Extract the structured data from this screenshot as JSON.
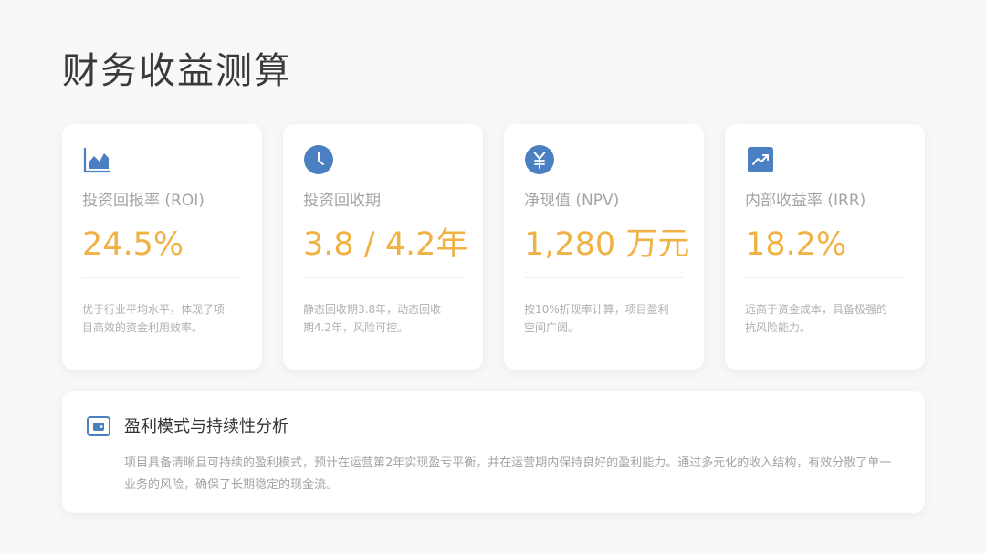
{
  "page": {
    "title": "财务收益测算"
  },
  "metrics": [
    {
      "icon": "area-chart-icon",
      "label": "投资回报率 (ROI)",
      "value": "24.5%",
      "description": "优于行业平均水平，体现了项目高效的资金利用效率。"
    },
    {
      "icon": "clock-icon",
      "label": "投资回收期",
      "value": "3.8 / 4.2年",
      "description": "静态回收期3.8年，动态回收期4.2年，风险可控。"
    },
    {
      "icon": "yen-icon",
      "label": "净现值 (NPV)",
      "value": "1,280 万元",
      "description": "按10%折现率计算，项目盈利空间广阔。"
    },
    {
      "icon": "trend-up-icon",
      "label": "内部收益率 (IRR)",
      "value": "18.2%",
      "description": "远高于资金成本，具备极强的抗风险能力。"
    }
  ],
  "analysis": {
    "icon": "wallet-icon",
    "title": "盈利模式与持续性分析",
    "description": "项目具备清晰且可持续的盈利模式，预计在运营第2年实现盈亏平衡，并在运营期内保持良好的盈利能力。通过多元化的收入结构，有效分散了单一业务的风险，确保了长期稳定的现金流。"
  },
  "colors": {
    "accent_blue": "#4a7fc1",
    "value_gold": "#f0b245",
    "label_gray": "#a4a4a4",
    "background": "#f7f8fa"
  }
}
